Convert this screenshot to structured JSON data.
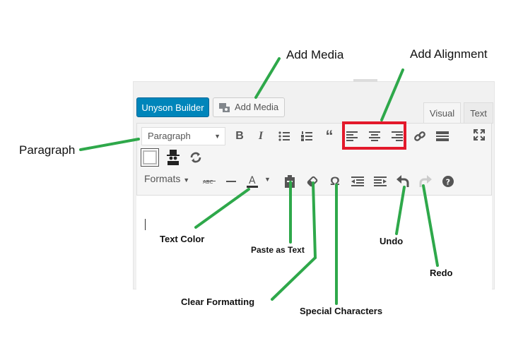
{
  "editor": {
    "builder_button": "Unyson Builder",
    "add_media_button": "Add Media",
    "tabs": [
      "Visual",
      "Text"
    ],
    "paragraph_select": "Paragraph",
    "formats_menu": "Formats",
    "toolbar_row1_icons": [
      "bold-icon",
      "italic-icon",
      "bullet-list-icon",
      "numbered-list-icon",
      "blockquote-icon",
      "align-left-icon",
      "align-center-icon",
      "align-right-icon",
      "link-icon",
      "read-more-icon",
      "fullscreen-icon"
    ],
    "toolbar_row2_icons": [
      "toolbar-toggle-icon",
      "spy-icon",
      "refresh-icon"
    ],
    "toolbar_row3_icons": [
      "strikethrough-icon",
      "horizontal-line-icon",
      "text-color-icon",
      "paste-text-icon",
      "clear-formatting-icon",
      "special-character-icon",
      "outdent-icon",
      "indent-icon",
      "undo-icon",
      "redo-icon",
      "help-icon"
    ]
  },
  "annotations": {
    "add_media": "Add Media",
    "add_alignment": "Add Alignment",
    "paragraph": "Paragraph",
    "text_color": "Text Color",
    "paste_as_text": "Paste as Text",
    "clear_formatting": "Clear Formatting",
    "special_characters": "Special Characters",
    "undo": "Undo",
    "redo": "Redo"
  },
  "colors": {
    "arrow": "#2ea84a",
    "highlight": "#e3192b",
    "primary": "#0085ba"
  }
}
